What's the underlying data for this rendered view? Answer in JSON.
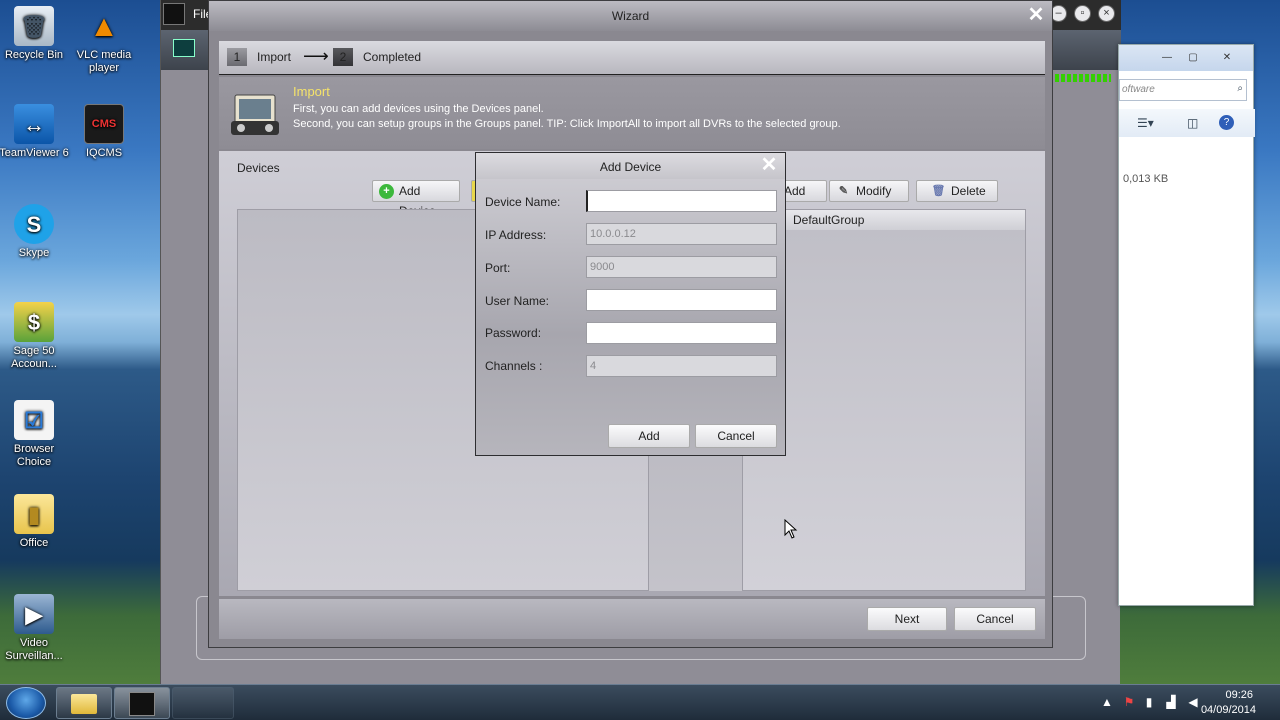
{
  "desktop": {
    "icons": [
      {
        "label": "Recycle Bin",
        "glyph": "recycle-bin-icon"
      },
      {
        "label": "VLC media player",
        "glyph": "vlc-icon"
      },
      {
        "label": "TeamViewer 6",
        "glyph": "teamviewer-icon"
      },
      {
        "label": "IQCMS",
        "glyph": "iqcms-icon"
      },
      {
        "label": "Skype",
        "glyph": "skype-icon"
      },
      {
        "label": "Sage 50 Accoun...",
        "glyph": "sage-icon"
      },
      {
        "label": "Browser Choice",
        "glyph": "browser-choice-icon"
      },
      {
        "label": "Office",
        "glyph": "folder-icon"
      },
      {
        "label": "Video Surveillan...",
        "glyph": "video-surveillance-icon"
      }
    ]
  },
  "app": {
    "title": "File"
  },
  "explorer": {
    "search_placeholder": "oftware",
    "file_size": "0,013 KB"
  },
  "wizard": {
    "title": "Wizard",
    "steps": [
      {
        "number": "1",
        "label": "Import"
      },
      {
        "number": "2",
        "label": "Completed"
      }
    ],
    "info": {
      "title": "Import",
      "line1": "First, you can add devices using the Devices panel.",
      "line2": "Second, you can setup groups in the Groups panel. TIP: Click ImportAll to import all DVRs to the selected group."
    },
    "devices_label": "Devices",
    "buttons": {
      "add_device": "Add Device",
      "add_group": "Add",
      "modify": "Modify",
      "delete": "Delete",
      "next": "Next",
      "cancel": "Cancel"
    },
    "groups": [
      "DefaultGroup"
    ]
  },
  "dialog": {
    "title": "Add Device",
    "fields": {
      "device_name_label": "Device Name:",
      "device_name_value": "",
      "ip_label": "IP Address:",
      "ip_value": "10.0.0.12",
      "port_label": "Port:",
      "port_value": "9000",
      "username_label": "User Name:",
      "username_value": "",
      "password_label": "Password:",
      "password_value": "",
      "channels_label": "Channels :",
      "channels_value": "4"
    },
    "add_label": "Add",
    "cancel_label": "Cancel"
  },
  "taskbar": {
    "time": "09:26",
    "date": "04/09/2014"
  },
  "colors": {
    "info_title": "#f5e36a",
    "signal_green": "#33d000"
  }
}
